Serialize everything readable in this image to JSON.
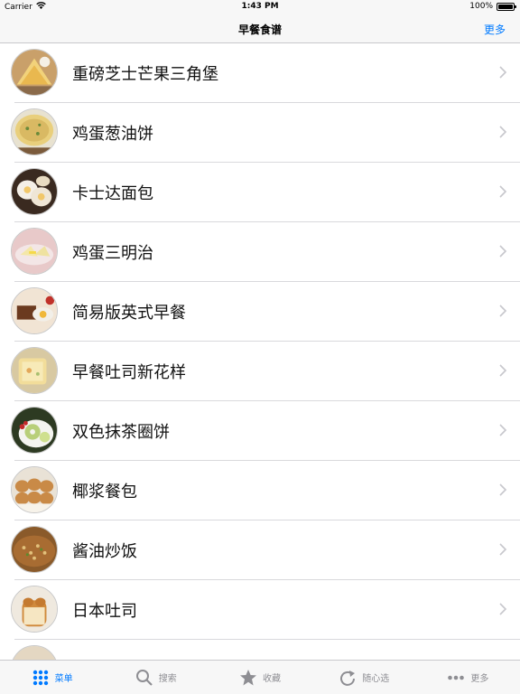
{
  "status_bar": {
    "carrier": "Carrier",
    "time": "1:43 PM",
    "battery": "100%"
  },
  "nav": {
    "title": "早餐食谱",
    "more_label": "更多"
  },
  "recipes": [
    {
      "name": "重磅芝士芒果三角堡",
      "icon": "recipe-photo-icon"
    },
    {
      "name": "鸡蛋葱油饼",
      "icon": "recipe-photo-icon"
    },
    {
      "name": "卡士达面包",
      "icon": "recipe-photo-icon"
    },
    {
      "name": "鸡蛋三明治",
      "icon": "recipe-photo-icon"
    },
    {
      "name": "简易版英式早餐",
      "icon": "recipe-photo-icon"
    },
    {
      "name": "早餐吐司新花样",
      "icon": "recipe-photo-icon"
    },
    {
      "name": "双色抹茶圈饼",
      "icon": "recipe-photo-icon"
    },
    {
      "name": "椰浆餐包",
      "icon": "recipe-photo-icon"
    },
    {
      "name": "酱油炒饭",
      "icon": "recipe-photo-icon"
    },
    {
      "name": "日本吐司",
      "icon": "recipe-photo-icon"
    },
    {
      "name": "",
      "icon": "recipe-photo-icon"
    }
  ],
  "tabs": [
    {
      "label": "菜单",
      "icon": "grid-dots-icon",
      "active": true
    },
    {
      "label": "搜索",
      "icon": "search-icon",
      "active": false
    },
    {
      "label": "收藏",
      "icon": "star-icon",
      "active": false
    },
    {
      "label": "随心选",
      "icon": "refresh-icon",
      "active": false
    },
    {
      "label": "更多",
      "icon": "more-dots-icon",
      "active": false
    }
  ],
  "colors": {
    "accent": "#007aff",
    "inactive": "#8e8e93",
    "bar_background": "#f7f7f7"
  }
}
